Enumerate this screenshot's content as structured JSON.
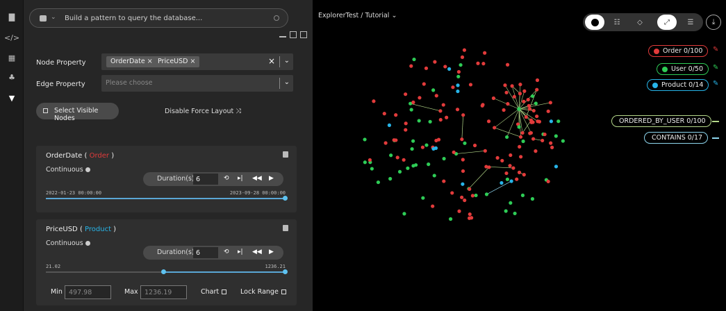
{
  "search": {
    "placeholder": "Build a pattern to query the database..."
  },
  "filters": {
    "node_property_label": "Node Property",
    "node_tags": [
      "OrderDate",
      "PriceUSD"
    ],
    "edge_property_label": "Edge Property",
    "edge_placeholder": "Please choose",
    "select_visible_label": "Select Visible Nodes",
    "disable_force_label": "Disable Force Layout"
  },
  "cards": [
    {
      "property": "OrderDate",
      "label": "Order",
      "label_color": "#e23b3b",
      "mode": "Continuous",
      "duration_label": "Duration(s):",
      "duration": "6",
      "range_start": "2022-01-23 00:00:00",
      "range_end": "2023-09-28 00:00:00"
    },
    {
      "property": "PriceUSD",
      "label": "Product",
      "label_color": "#27b4e8",
      "mode": "Continuous",
      "duration_label": "Duration(s):",
      "duration": "6",
      "range_start": "21.02",
      "range_end": "1236.21",
      "min_label": "Min",
      "min": "497.98",
      "max_label": "Max",
      "max": "1236.19",
      "chart_label": "Chart",
      "lock_label": "Lock Range"
    }
  ],
  "graph": {
    "breadcrumb": "ExplorerTest  / Tutorial",
    "legend_nodes": [
      {
        "label": "Order 0/100",
        "color": "#e23b3b"
      },
      {
        "label": "User 0/50",
        "color": "#2ecc56"
      },
      {
        "label": "Product 0/14",
        "color": "#27b4e8"
      }
    ],
    "legend_edges": [
      {
        "label": "ORDERED_BY_USER 0/100",
        "color": "#b5d98a"
      },
      {
        "label": "CONTAINS 0/17",
        "color": "#8ed7ef"
      }
    ]
  }
}
